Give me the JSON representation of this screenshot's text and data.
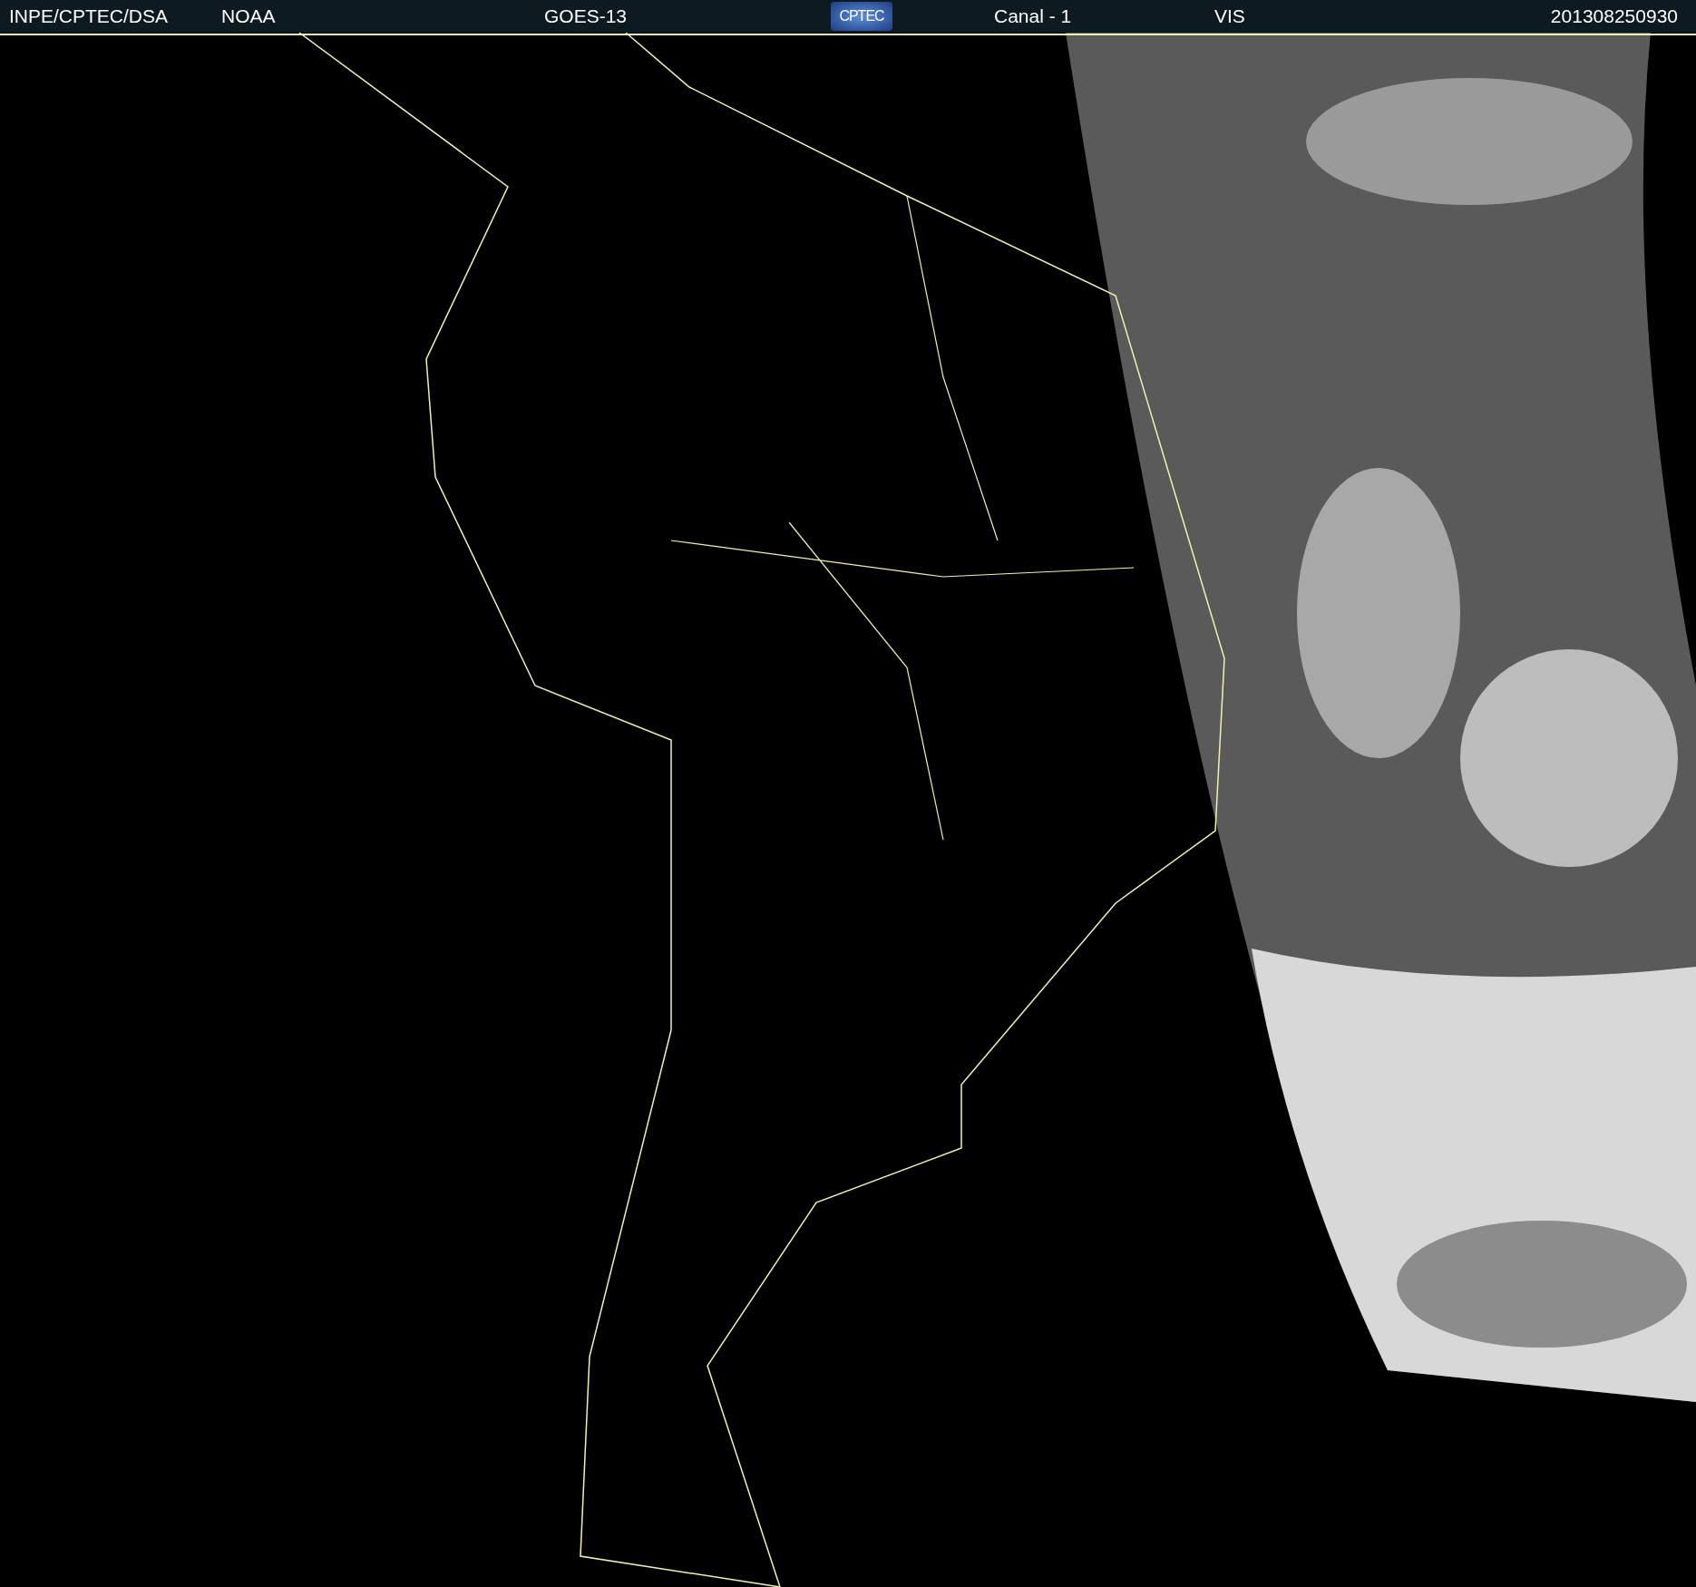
{
  "header": {
    "source": "INPE/CPTEC/DSA",
    "agency": "NOAA",
    "satellite": "GOES-13",
    "logo": "CPTEC",
    "channel": "Canal - 1",
    "band": "VIS",
    "timestamp": "201308250930"
  }
}
